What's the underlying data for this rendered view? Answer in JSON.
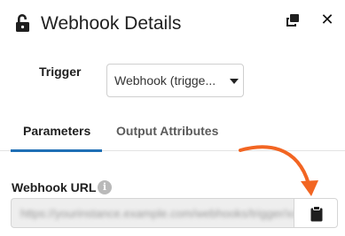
{
  "header": {
    "title": "Webhook Details",
    "icons": {
      "lock": "unlock-icon",
      "popout": "popout-icon",
      "close": "close-icon"
    },
    "close_glyph": "✕"
  },
  "trigger": {
    "label": "Trigger",
    "selected": "Webhook (trigge..."
  },
  "tabs": [
    {
      "label": "Parameters",
      "active": true
    },
    {
      "label": "Output Attributes",
      "active": false
    }
  ],
  "webhook_url": {
    "label": "Webhook URL",
    "info_glyph": "i",
    "value": "https://yourinstance.example.com/webhooks/trigger/xxxxxxxxxxxx",
    "copy_icon": "clipboard-icon"
  },
  "colors": {
    "accent": "#1f6fb5",
    "annotation_arrow": "#f26522"
  }
}
